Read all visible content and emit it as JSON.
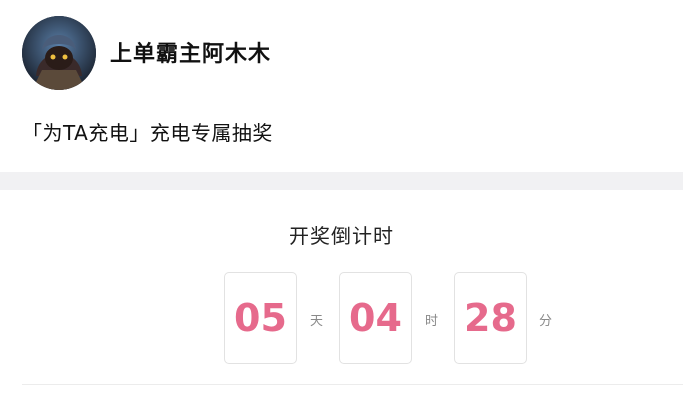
{
  "user": {
    "name": "上单霸主阿木木"
  },
  "post": {
    "title": "「为TA充电」充电专属抽奖"
  },
  "countdown": {
    "title": "开奖倒计时",
    "days": "05",
    "days_unit": "天",
    "hours": "04",
    "hours_unit": "时",
    "minutes": "28",
    "minutes_unit": "分"
  },
  "colors": {
    "accent": "#e66a8c",
    "band": "#f1f1f3"
  }
}
